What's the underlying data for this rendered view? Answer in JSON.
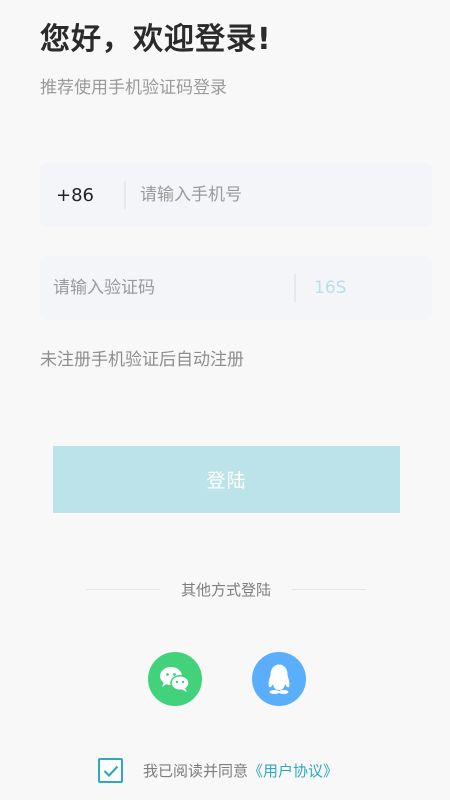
{
  "header": {
    "title": "您好，欢迎登录!",
    "subtitle": "推荐使用手机验证码登录"
  },
  "phone": {
    "country_code": "+86",
    "placeholder": "请输入手机号"
  },
  "code": {
    "placeholder": "请输入验证码",
    "countdown": "16S"
  },
  "hint": "未注册手机验证后自动注册",
  "login_button": "登陆",
  "other_login": {
    "label": "其他方式登陆",
    "options": [
      "wechat-icon",
      "qq-icon"
    ]
  },
  "agreement": {
    "checked": true,
    "text": "我已阅读并同意",
    "link": "《用户协议》"
  },
  "colors": {
    "background": "#f8f8f9",
    "input_bg": "#f3f5f8",
    "button": "#bce3e9",
    "accent": "#2ea9bf",
    "wechat": "#41d27b",
    "qq": "#5aaefc"
  }
}
